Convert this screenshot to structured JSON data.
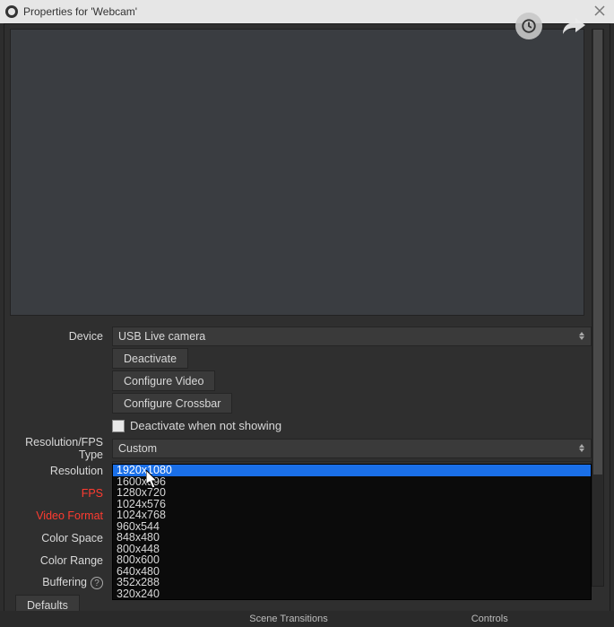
{
  "titlebar": {
    "title": "Properties for 'Webcam'"
  },
  "overlay": {
    "clock_icon": "clock-icon",
    "share_icon": "share-icon"
  },
  "form": {
    "device_label": "Device",
    "device_value": "USB  Live camera",
    "deactivate_btn": "Deactivate",
    "configure_video_btn": "Configure Video",
    "configure_crossbar_btn": "Configure Crossbar",
    "deactivate_checkbox_label": "Deactivate when not showing",
    "resfps_label": "Resolution/FPS Type",
    "resfps_value": "Custom",
    "resolution_label": "Resolution",
    "resolution_value": "",
    "fps_label": "FPS",
    "video_format_label": "Video Format",
    "color_space_label": "Color Space",
    "color_range_label": "Color Range",
    "buffering_label": "Buffering",
    "defaults_btn": "Defaults"
  },
  "dropdown": {
    "options": [
      "1920x1080",
      "1600x896",
      "1280x720",
      "1024x576",
      "1024x768",
      "960x544",
      "848x480",
      "800x448",
      "800x600",
      "640x480",
      "352x288",
      "320x240"
    ],
    "highlight_index": 0
  },
  "footer": {
    "center": "Scene Transitions",
    "right": "Controls"
  }
}
